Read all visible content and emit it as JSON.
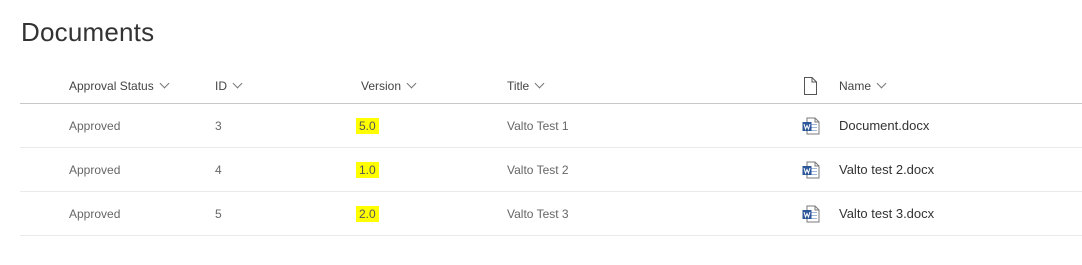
{
  "page": {
    "title": "Documents"
  },
  "columns": {
    "approval_status": "Approval Status",
    "id": "ID",
    "version": "Version",
    "title": "Title",
    "name": "Name"
  },
  "rows": [
    {
      "approval_status": "Approved",
      "id": "3",
      "version": "5.0",
      "title": "Valto Test 1",
      "name": "Document.docx"
    },
    {
      "approval_status": "Approved",
      "id": "4",
      "version": "1.0",
      "title": "Valto Test 2",
      "name": "Valto test 2.docx"
    },
    {
      "approval_status": "Approved",
      "id": "5",
      "version": "2.0",
      "title": "Valto Test 3",
      "name": "Valto test 3.docx"
    }
  ],
  "icons": {
    "file_type_header": "document-outline-icon",
    "file_type_row": "word-document-icon",
    "sort": "chevron-down-icon"
  },
  "colors": {
    "version_highlight": "#ffff00",
    "word_blue": "#2b579a"
  }
}
